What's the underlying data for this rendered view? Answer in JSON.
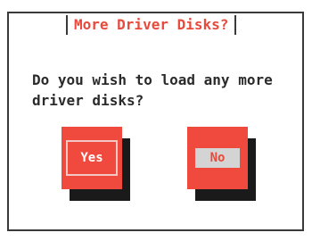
{
  "dialog": {
    "title": "More Driver Disks?",
    "message": "Do you wish to load any more\ndriver disks?",
    "buttons": {
      "yes_label": "Yes",
      "no_label": "No",
      "focused": "No"
    }
  },
  "colors": {
    "accent": "#e84a3c",
    "button_bg": "#ef4a3d",
    "shadow": "#1a1a1a",
    "border": "#3a3a3a",
    "text": "#2b2b2b"
  }
}
